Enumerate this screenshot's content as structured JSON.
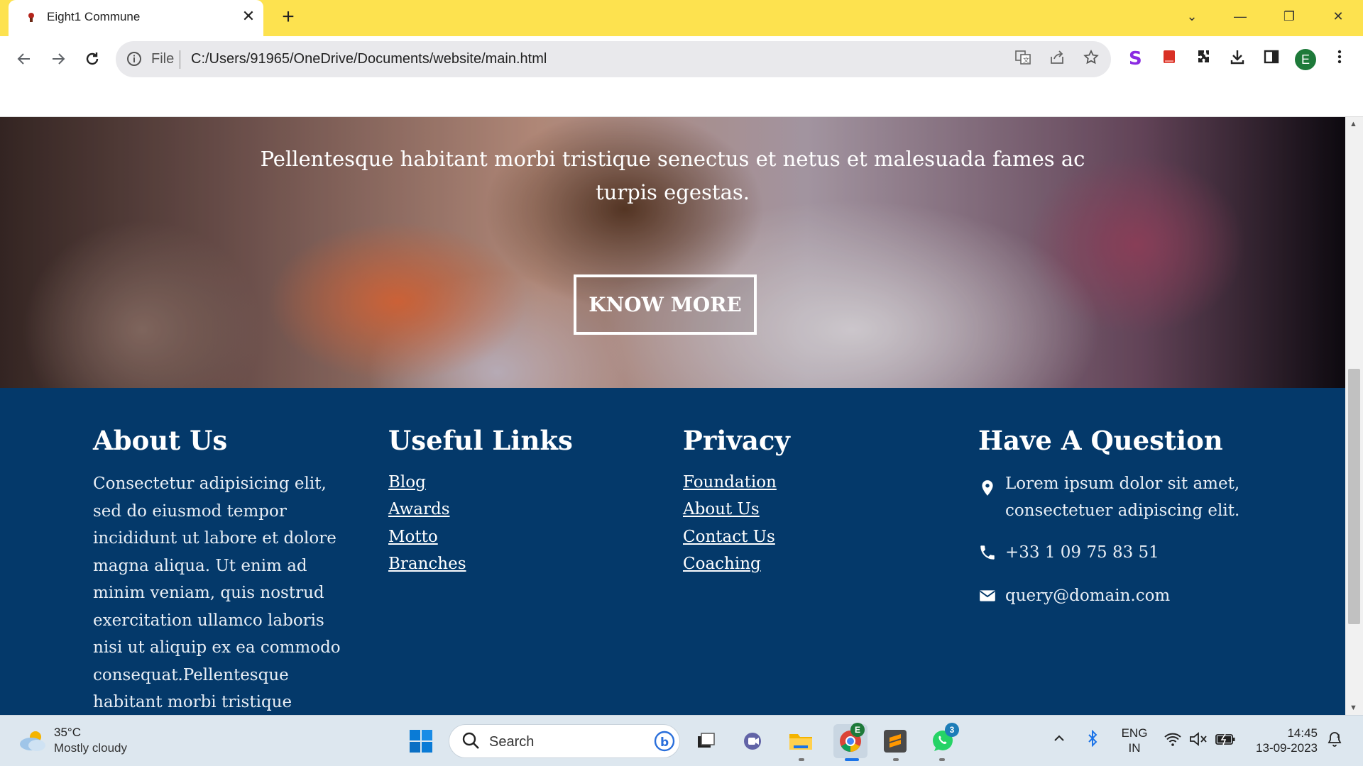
{
  "browser": {
    "tab": {
      "title": "Eight1 Commune",
      "close_glyph": "✕"
    },
    "new_tab_glyph": "+",
    "window_controls": {
      "chevron": "⌄",
      "minimize": "—",
      "restore": "❐",
      "close": "✕"
    },
    "address_bar": {
      "scheme_label": "File",
      "url": "C:/Users/91965/OneDrive/Documents/website/main.html"
    },
    "profile_initial": "E",
    "icons": [
      "back-icon",
      "forward-icon",
      "reload-icon",
      "info-icon",
      "translate-icon",
      "share-icon",
      "star-icon",
      "stylus-extension-icon",
      "red-extension-icon",
      "extensions-puzzle-icon",
      "download-icon",
      "sidepanel-icon",
      "menu-dots-icon"
    ]
  },
  "hero": {
    "text": "Pellentesque habitant morbi tristique senectus et netus et malesuada fames ac turpis egestas.",
    "button_label": "KNOW MORE"
  },
  "footer": {
    "about": {
      "heading": "About Us",
      "text": "Consectetur adipisicing elit, sed do eiusmod tempor incididunt ut labore et dolore magna aliqua. Ut enim ad minim veniam, quis nostrud exercitation ullamco laboris nisi ut aliquip ex ea commodo consequat.Pellentesque habitant morbi tristique senectus et netus"
    },
    "useful_links": {
      "heading": "Useful Links",
      "items": [
        "Blog",
        "Awards",
        "Motto",
        "Branches"
      ]
    },
    "privacy": {
      "heading": "Privacy",
      "items": [
        "Foundation",
        "About Us",
        "Contact Us",
        "Coaching"
      ]
    },
    "question": {
      "heading": "Have A Question",
      "address_line1": "Lorem ipsum dolor sit amet,",
      "address_line2": "consectetuer adipiscing elit.",
      "phone": "+33 1 09 75 83 51",
      "email": "query@domain.com"
    }
  },
  "taskbar": {
    "weather": {
      "temp": "35°C",
      "desc": "Mostly cloudy"
    },
    "search_label": "Search",
    "chrome_badge": "E",
    "whatsapp_badge": "3",
    "language": {
      "line1": "ENG",
      "line2": "IN"
    },
    "clock": {
      "time": "14:45",
      "date": "13-09-2023"
    }
  },
  "colors": {
    "tabstrip": "#fde24f",
    "footer_bg": "#04396a",
    "profile": "#1e7a3a"
  }
}
